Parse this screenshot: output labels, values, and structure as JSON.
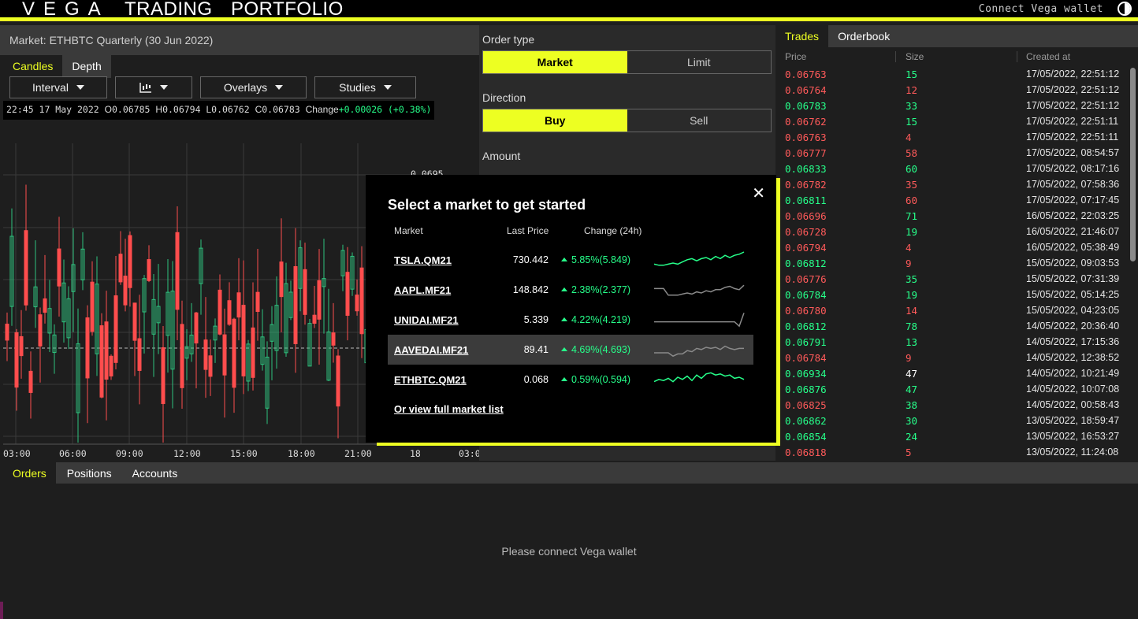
{
  "colors": {
    "accent": "#edff22",
    "up": "#26ff8a",
    "down": "#ff5a5a",
    "bg": "#1e1e1e"
  },
  "topbar": {
    "logo": "VEGA",
    "nav": [
      "TRADING",
      "PORTFOLIO"
    ],
    "connect_label": "Connect Vega wallet",
    "theme_icon": "half-circle-icon"
  },
  "chart": {
    "market_title": "Market: ETHBTC Quarterly (30 Jun 2022)",
    "tabs": [
      "Candles",
      "Depth"
    ],
    "toolbar": {
      "interval": "Interval",
      "chart_type_icon": "candlestick-chart-icon",
      "overlays": "Overlays",
      "studies": "Studies"
    },
    "ohlc": {
      "time": "22:45 17 May 2022",
      "o_label": "O",
      "o": "0.06785",
      "h_label": "H",
      "h": "0.06794",
      "l_label": "L",
      "l": "0.06762",
      "c_label": "C",
      "c": "0.06783",
      "change_label": "Change",
      "change": "+0.00026 (+0.38%)"
    },
    "y_tick": "0.0695",
    "x_ticks": [
      "03:00",
      "06:00",
      "09:00",
      "12:00",
      "15:00",
      "18:00",
      "21:00",
      "18",
      "03:0"
    ]
  },
  "order": {
    "order_type_label": "Order type",
    "order_types": [
      "Market",
      "Limit"
    ],
    "selected_type": "Market",
    "direction_label": "Direction",
    "directions": [
      "Buy",
      "Sell"
    ],
    "selected_direction": "Buy",
    "amount_label": "Amount"
  },
  "trades": {
    "tabs": [
      "Trades",
      "Orderbook"
    ],
    "columns": [
      "Price",
      "Size",
      "Created at"
    ],
    "rows": [
      {
        "price": "0.06763",
        "size": "15",
        "time": "17/05/2022, 22:51:12",
        "dir": "neg",
        "sdir": "pos"
      },
      {
        "price": "0.06764",
        "size": "12",
        "time": "17/05/2022, 22:51:12",
        "dir": "neg",
        "sdir": "neg"
      },
      {
        "price": "0.06783",
        "size": "33",
        "time": "17/05/2022, 22:51:12",
        "dir": "pos",
        "sdir": "pos"
      },
      {
        "price": "0.06762",
        "size": "15",
        "time": "17/05/2022, 22:51:11",
        "dir": "neg",
        "sdir": "pos"
      },
      {
        "price": "0.06763",
        "size": "4",
        "time": "17/05/2022, 22:51:11",
        "dir": "neg",
        "sdir": "neg"
      },
      {
        "price": "0.06777",
        "size": "58",
        "time": "17/05/2022, 08:54:57",
        "dir": "neg",
        "sdir": "neg"
      },
      {
        "price": "0.06833",
        "size": "60",
        "time": "17/05/2022, 08:17:16",
        "dir": "pos",
        "sdir": "pos"
      },
      {
        "price": "0.06782",
        "size": "35",
        "time": "17/05/2022, 07:58:36",
        "dir": "neg",
        "sdir": "neg"
      },
      {
        "price": "0.06811",
        "size": "60",
        "time": "17/05/2022, 07:17:45",
        "dir": "pos",
        "sdir": "neg"
      },
      {
        "price": "0.06696",
        "size": "71",
        "time": "16/05/2022, 22:03:25",
        "dir": "neg",
        "sdir": "pos"
      },
      {
        "price": "0.06728",
        "size": "19",
        "time": "16/05/2022, 21:46:07",
        "dir": "neg",
        "sdir": "pos"
      },
      {
        "price": "0.06794",
        "size": "4",
        "time": "16/05/2022, 05:38:49",
        "dir": "neg",
        "sdir": "neg"
      },
      {
        "price": "0.06812",
        "size": "9",
        "time": "15/05/2022, 09:03:53",
        "dir": "pos",
        "sdir": "neg"
      },
      {
        "price": "0.06776",
        "size": "35",
        "time": "15/05/2022, 07:31:39",
        "dir": "neg",
        "sdir": "pos"
      },
      {
        "price": "0.06784",
        "size": "19",
        "time": "15/05/2022, 05:14:25",
        "dir": "pos",
        "sdir": "pos"
      },
      {
        "price": "0.06780",
        "size": "14",
        "time": "15/05/2022, 04:23:05",
        "dir": "neg",
        "sdir": "neg"
      },
      {
        "price": "0.06812",
        "size": "78",
        "time": "14/05/2022, 20:36:40",
        "dir": "pos",
        "sdir": "pos"
      },
      {
        "price": "0.06791",
        "size": "13",
        "time": "14/05/2022, 17:15:36",
        "dir": "pos",
        "sdir": "pos"
      },
      {
        "price": "0.06784",
        "size": "9",
        "time": "14/05/2022, 12:38:52",
        "dir": "neg",
        "sdir": "neg"
      },
      {
        "price": "0.06934",
        "size": "47",
        "time": "14/05/2022, 10:21:49",
        "dir": "pos",
        "sdir": "neutral"
      },
      {
        "price": "0.06876",
        "size": "47",
        "time": "14/05/2022, 10:07:08",
        "dir": "pos",
        "sdir": "pos"
      },
      {
        "price": "0.06825",
        "size": "38",
        "time": "14/05/2022, 00:58:43",
        "dir": "neg",
        "sdir": "pos"
      },
      {
        "price": "0.06862",
        "size": "30",
        "time": "13/05/2022, 18:59:47",
        "dir": "pos",
        "sdir": "pos"
      },
      {
        "price": "0.06854",
        "size": "24",
        "time": "13/05/2022, 16:53:27",
        "dir": "pos",
        "sdir": "pos"
      },
      {
        "price": "0.06818",
        "size": "5",
        "time": "13/05/2022, 11:24:08",
        "dir": "neg",
        "sdir": "neg"
      }
    ]
  },
  "bottom": {
    "tabs": [
      "Orders",
      "Positions",
      "Accounts"
    ],
    "empty_message": "Please connect Vega wallet"
  },
  "modal": {
    "title": "Select a market to get started",
    "close_icon": "close-icon",
    "columns": [
      "Market",
      "Last Price",
      "Change (24h)"
    ],
    "markets": [
      {
        "name": "TSLA.QM21",
        "price": "730.442",
        "change": "5.85%(5.849)",
        "spark_color": "#26ff8a",
        "spark": [
          4,
          3,
          3,
          4,
          5,
          4,
          6,
          8,
          9,
          7,
          9,
          10,
          8,
          11,
          9,
          12,
          10,
          12,
          13,
          15
        ]
      },
      {
        "name": "AAPL.MF21",
        "price": "148.842",
        "change": "2.38%(2.377)",
        "spark_color": "#8a8a8a",
        "spark": [
          9,
          9,
          9,
          3,
          3,
          3,
          4,
          5,
          4,
          6,
          5,
          7,
          6,
          8,
          8,
          10,
          11,
          9,
          8,
          12
        ]
      },
      {
        "name": "UNIDAI.MF21",
        "price": "5.339",
        "change": "4.22%(4.219)",
        "spark_color": "#8a8a8a",
        "spark": [
          6,
          6,
          6,
          6,
          6,
          6,
          6,
          6,
          6,
          6,
          6,
          6,
          6,
          6,
          6,
          6,
          6,
          6,
          2,
          14
        ]
      },
      {
        "name": "AAVEDAI.MF21",
        "price": "89.41",
        "change": "4.69%(4.693)",
        "spark_color": "#8a8a8a",
        "spark": [
          5,
          5,
          5,
          5,
          2,
          4,
          4,
          7,
          6,
          9,
          8,
          10,
          9,
          10,
          8,
          11,
          9,
          8,
          9,
          9
        ]
      },
      {
        "name": "ETHBTC.QM21",
        "price": "0.068",
        "change": "0.59%(0.594)",
        "spark_color": "#26ff8a",
        "spark": [
          6,
          8,
          7,
          9,
          6,
          10,
          8,
          11,
          7,
          12,
          9,
          13,
          14,
          12,
          13,
          11,
          12,
          9,
          10,
          8
        ]
      }
    ],
    "highlighted": "AAVEDAI.MF21",
    "full_list_link": "Or view full market list"
  }
}
